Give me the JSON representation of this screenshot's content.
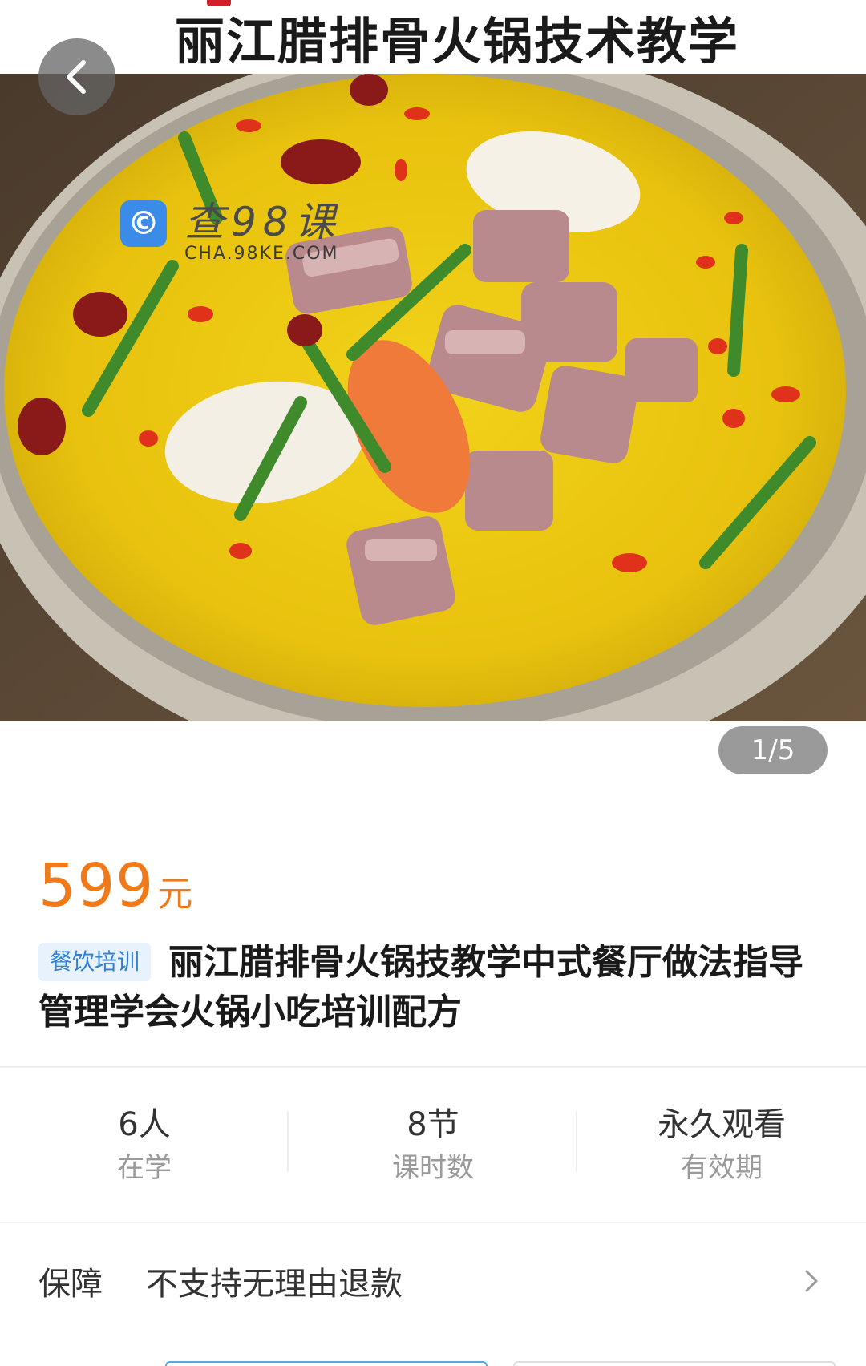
{
  "hero": {
    "banner_title": "丽江腊排骨火锅技术教学",
    "watermark_main": "查98课",
    "watermark_sub": "CHA.98KE.COM",
    "counter": "1/5",
    "icons": {
      "back": "chevron-left-icon",
      "logo": "watermark-logo-icon"
    }
  },
  "price": {
    "amount": "599",
    "unit": "元",
    "color": "#f07a1a"
  },
  "course": {
    "tag": "餐饮培训",
    "title": "丽江腊排骨火锅技教学中式餐厅做法指导管理学会火锅小吃培训配方"
  },
  "stats": [
    {
      "value": "6人",
      "label": "在学"
    },
    {
      "value": "8节",
      "label": "课时数"
    },
    {
      "value": "永久观看",
      "label": "有效期"
    }
  ],
  "guarantee": {
    "label": "保障",
    "text": "不支持无理由退款",
    "icon": "chevron-right-icon"
  }
}
